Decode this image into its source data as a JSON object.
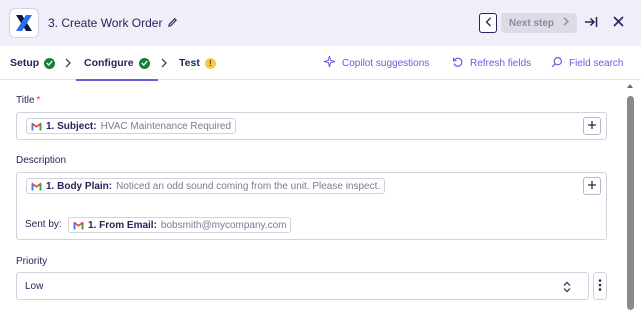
{
  "header": {
    "step_title": "3. Create Work Order",
    "prev_icon": "chevron-left-icon",
    "next_label": "Next step",
    "icons": {
      "edit": "pencil-icon",
      "expand": "arrow-right-to-bar-icon",
      "close": "close-icon"
    }
  },
  "tabs": {
    "items": [
      {
        "label": "Setup",
        "status": "complete"
      },
      {
        "label": "Configure",
        "status": "complete",
        "active": true
      },
      {
        "label": "Test",
        "status": "warning",
        "badge": "!"
      }
    ]
  },
  "tools": {
    "copilot": "Copilot suggestions",
    "refresh": "Refresh fields",
    "search": "Field search"
  },
  "form": {
    "title": {
      "label": "Title",
      "required_mark": "*",
      "pill_key": "1. Subject:",
      "pill_value": "HVAC Maintenance Required"
    },
    "description": {
      "label": "Description",
      "pill_key": "1. Body Plain:",
      "pill_value": "Noticed an odd sound coming from the unit. Please inspect.",
      "sent_by_label": "Sent by:",
      "sent_pill_key": "1. From Email:",
      "sent_pill_value": "bobsmith@mycompany.com"
    },
    "priority": {
      "label": "Priority",
      "value": "Low"
    }
  },
  "colors": {
    "accent": "#6a5bdc",
    "header_bg": "#f0eef9",
    "text": "#2b2358",
    "success": "#14803c",
    "warning": "#f2c94c",
    "required": "#d93b3b"
  }
}
